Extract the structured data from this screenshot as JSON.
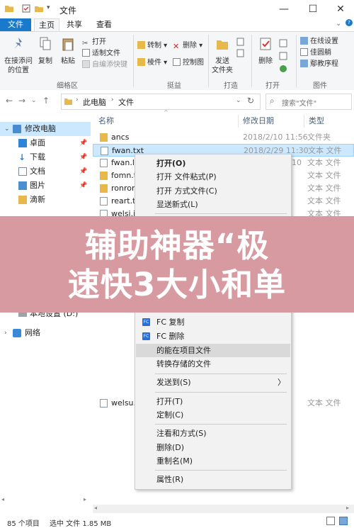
{
  "window": {
    "title": "文件",
    "minimize_glyph": "—",
    "maximize_glyph": "☐",
    "close_glyph": "✕"
  },
  "tabs": [
    {
      "label": "文件"
    },
    {
      "label": "主页"
    },
    {
      "label": "共享"
    },
    {
      "label": "查看"
    }
  ],
  "ribbon": {
    "pin": "在接添问的位置",
    "copy": "复制",
    "paste": "粘贴",
    "cut": "打开",
    "copy_path": "适制文件",
    "paste_shortcut": "自编添快键",
    "clipboard_label": "细格区",
    "move_to": "转制",
    "copy_to": "棱件",
    "delete": "删除",
    "rename": "控制图",
    "organize_label": "挺益",
    "new_folder": "发送",
    "new_folder2": "文件夹",
    "new_label": "打造",
    "properties": "删除",
    "open_label": "打开",
    "select_all": "在线设置",
    "select_none": "佳圆艄",
    "invert": "鄢教序程",
    "select_label": "图件"
  },
  "address": {
    "crumb1": "此电脑",
    "crumb2": "文件",
    "search_placeholder": "搜索\"文件\""
  },
  "sidebar": {
    "items": [
      {
        "label": "修改电脑"
      },
      {
        "label": "卓面"
      },
      {
        "label": "下载"
      },
      {
        "label": "文档"
      },
      {
        "label": "图片"
      },
      {
        "label": "滴新"
      },
      {
        "label": "本地设置 (D:)"
      },
      {
        "label": "网络"
      }
    ]
  },
  "columns": {
    "name": "名称",
    "date": "修改日期",
    "type": "类型"
  },
  "files": [
    {
      "name": "ancs",
      "date": "2018/2/10 11:56",
      "type": "文件夹"
    },
    {
      "name": "fwan.txt",
      "date": "2018/2/29 11:30",
      "type": "文本 文件"
    },
    {
      "name": "fwan.ly",
      "date": "10",
      "type": "文本 文件"
    },
    {
      "name": "fomn.t",
      "date": "",
      "type": "文本 文件"
    },
    {
      "name": "ronron",
      "date": "",
      "type": "文本 文件"
    },
    {
      "name": "reart.tp",
      "date": "",
      "type": "文本 文件"
    },
    {
      "name": "welsi.it",
      "date": "",
      "type": "文本 文件"
    },
    {
      "name": "welsu.g",
      "date": "",
      "type": "文本 文件"
    }
  ],
  "context_menu": {
    "open": "打开(O)",
    "open_format": "打开 文件粘式(P)",
    "open_with": "打开 方式文件(C)",
    "show_new": "显送新式(L)",
    "fc_copy": "FC 复制",
    "fc_delete": "FC 删除",
    "open_in_project": "的能在项目文件",
    "convert": "转换存储的文件",
    "send_to": "发送到(S)",
    "open2": "打开(T)",
    "customize": "定制(C)",
    "note_mode": "注看和方式(S)",
    "delete": "删除(D)",
    "rename": "重制名(M)",
    "properties": "属性(R)",
    "submenu_arrow": "〉"
  },
  "status": {
    "count": "85 个项目",
    "selected": "选中 文件 1.85 MB"
  },
  "banner": {
    "line1": "辅助神器“极",
    "line2": "速快3大小和单"
  },
  "colors": {
    "accent": "#1979ca",
    "selection": "#cce8ff",
    "banner": "#d69aa0",
    "folder": "#e8b84a"
  }
}
